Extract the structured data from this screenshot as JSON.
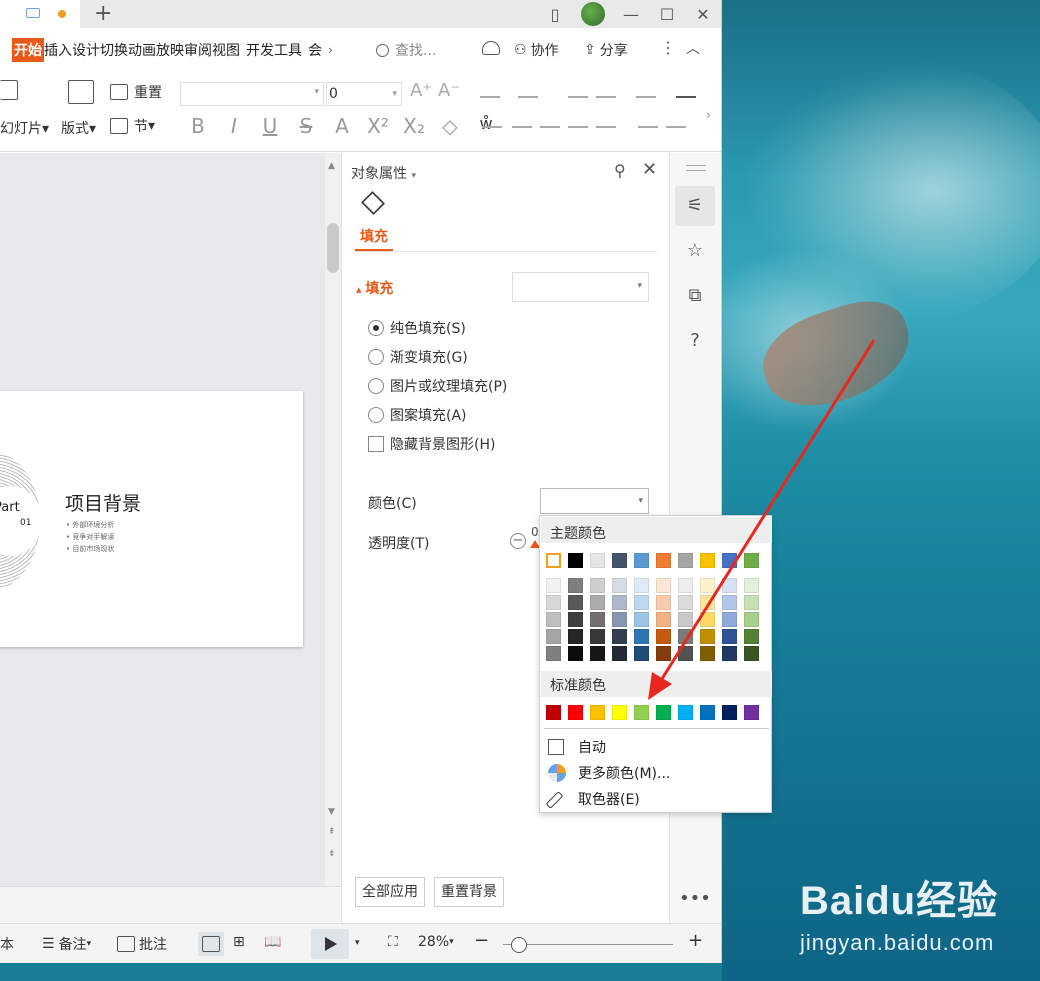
{
  "app": {
    "menu_tabs": [
      "开始",
      "插入",
      "设计",
      "切换",
      "动画",
      "放映",
      "审阅",
      "视图",
      "开发工具",
      "会"
    ],
    "search_placeholder": "查找...",
    "collab_label": "协作",
    "share_label": "分享"
  },
  "ribbon": {
    "new_slide_label": "幻灯片",
    "layout_label": "版式",
    "reset_label": "重置",
    "section_label": "节",
    "font_size_value": "0"
  },
  "slide": {
    "part_label": "Part",
    "part_number": "01",
    "title": "项目背景",
    "bullets": [
      "外部环境分析",
      "竞争对手解读",
      "目前市场现状"
    ]
  },
  "pane": {
    "title": "对象属性",
    "fill_tab": "填充",
    "section_fill": "填充",
    "options": [
      {
        "label": "纯色填充(S)",
        "checked": true
      },
      {
        "label": "渐变填充(G)",
        "checked": false
      },
      {
        "label": "图片或纹理填充(P)",
        "checked": false
      },
      {
        "label": "图案填充(A)",
        "checked": false
      }
    ],
    "hide_bg_label": "隐藏背景图形(H)",
    "color_label": "颜色(C)",
    "transparency_label": "透明度(T)",
    "transparency_value": "0",
    "apply_all": "全部应用",
    "reset_bg": "重置背景"
  },
  "picker": {
    "theme_header": "主题颜色",
    "standard_header": "标准颜色",
    "auto_label": "自动",
    "more_colors_label": "更多颜色(M)...",
    "eyedropper_label": "取色器(E)",
    "theme_colors": [
      "#ffffff",
      "#000000",
      "#e7e6e6",
      "#44546a",
      "#5b9bd5",
      "#ed7d31",
      "#a5a5a5",
      "#ffc000",
      "#4472c4",
      "#70ad47"
    ],
    "theme_shades": [
      [
        "#f2f2f2",
        "#7f7f7f",
        "#d0cece",
        "#d6dce4",
        "#deebf6",
        "#fbe5d5",
        "#ededed",
        "#fff2cc",
        "#d9e2f3",
        "#e2efd9"
      ],
      [
        "#d8d8d8",
        "#595959",
        "#aeabab",
        "#adb9ca",
        "#bdd7ee",
        "#f7cbac",
        "#dbdbdb",
        "#fee599",
        "#b4c6e7",
        "#c5e0b3"
      ],
      [
        "#bfbfbf",
        "#3f3f3f",
        "#757070",
        "#8496b0",
        "#9cc3e5",
        "#f4b183",
        "#c9c9c9",
        "#ffd965",
        "#8eaadb",
        "#a8d08d"
      ],
      [
        "#a5a5a5",
        "#262626",
        "#3a3838",
        "#323f4f",
        "#2e75b5",
        "#c55a11",
        "#7b7b7b",
        "#bf9000",
        "#2f5496",
        "#538135"
      ],
      [
        "#7f7f7f",
        "#0c0c0c",
        "#171616",
        "#222a35",
        "#1e4e79",
        "#843c0b",
        "#525252",
        "#7f6000",
        "#1f3864",
        "#375623"
      ]
    ],
    "standard_colors": [
      "#c00000",
      "#ff0000",
      "#ffc000",
      "#ffff00",
      "#92d050",
      "#00b050",
      "#00b0f0",
      "#0070c0",
      "#002060",
      "#7030a0"
    ]
  },
  "statusbar": {
    "notes_label": "备注",
    "comments_label": "批注",
    "zoom": "28%",
    "left_clip": "本"
  },
  "watermark": {
    "logo": "Baidu经验",
    "site": "jingyan.baidu.com"
  }
}
